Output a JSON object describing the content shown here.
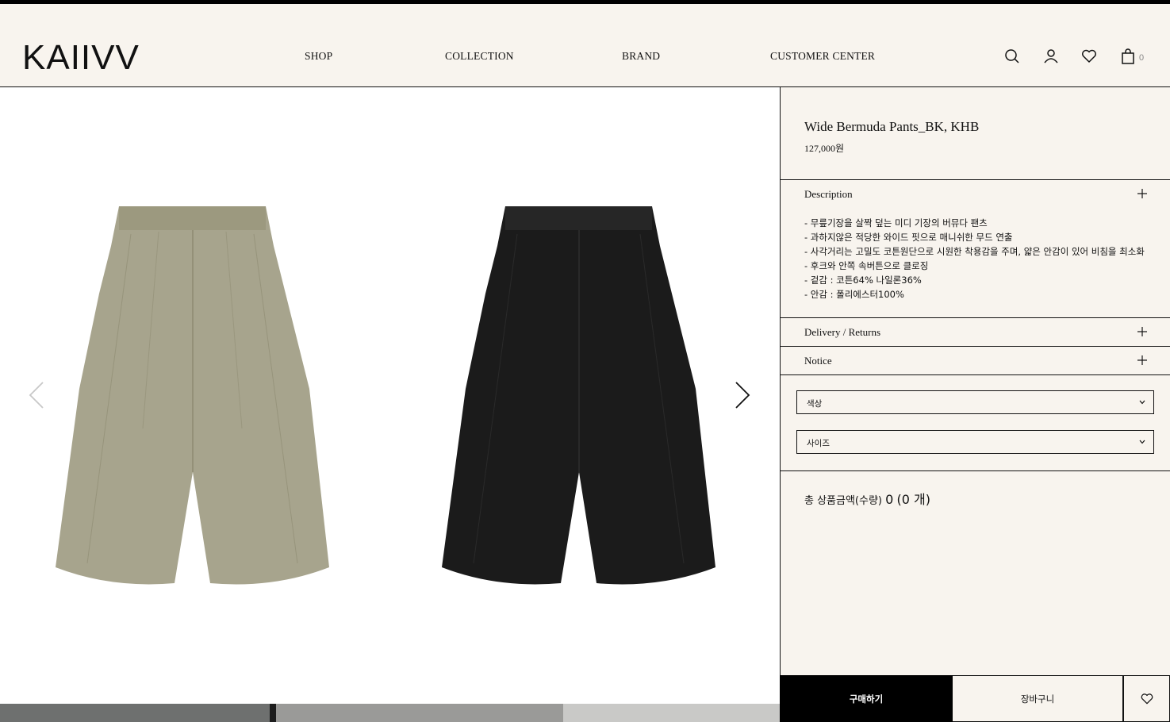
{
  "header": {
    "logo": "KAIIVV",
    "nav": [
      "SHOP",
      "COLLECTION",
      "BRAND",
      "CUSTOMER CENTER"
    ],
    "icons": [
      "search-icon",
      "user-icon",
      "heart-icon",
      "bag-icon"
    ],
    "cart_count": "0"
  },
  "gallery": {
    "images": [
      {
        "name": "khaki-bermuda-pants",
        "color": "#a7a48d"
      },
      {
        "name": "black-bermuda-pants",
        "color": "#1b1b1b"
      }
    ],
    "prev_icon": "chevron-left-icon",
    "next_icon": "chevron-right-icon"
  },
  "product": {
    "title": "Wide Bermuda Pants_BK, KHB",
    "price": "127,000원"
  },
  "sections": {
    "description": {
      "label": "Description",
      "lines": [
        "- 무릎기장을 살짝 덮는 미디 기장의 버뮤다 팬츠",
        "- 과하지않은 적당한 와이드 핏으로 매니쉬한 무드 연출",
        "- 사각거리는 고밀도 코튼원단으로 시원한 착용감을 주며, 얇은 안감이 있어 비침을 최소화",
        "- 후크와 안쪽 속버튼으로 클로징",
        "- 겉감 : 코튼64% 나일론36%",
        "- 안감 : 폴리에스터100%"
      ]
    },
    "delivery": {
      "label": "Delivery / Returns"
    },
    "notice": {
      "label": "Notice"
    }
  },
  "options": {
    "color_placeholder": "색상",
    "size_placeholder": "사이즈"
  },
  "total": {
    "label": "총 상품금액(수량)",
    "amount": "0",
    "qty": "(0 개)"
  },
  "actions": {
    "buy": "구매하기",
    "cart": "장바구니"
  },
  "colors": {
    "background": "#f8f4ee",
    "black": "#000000",
    "khaki": "#a7a48d"
  }
}
